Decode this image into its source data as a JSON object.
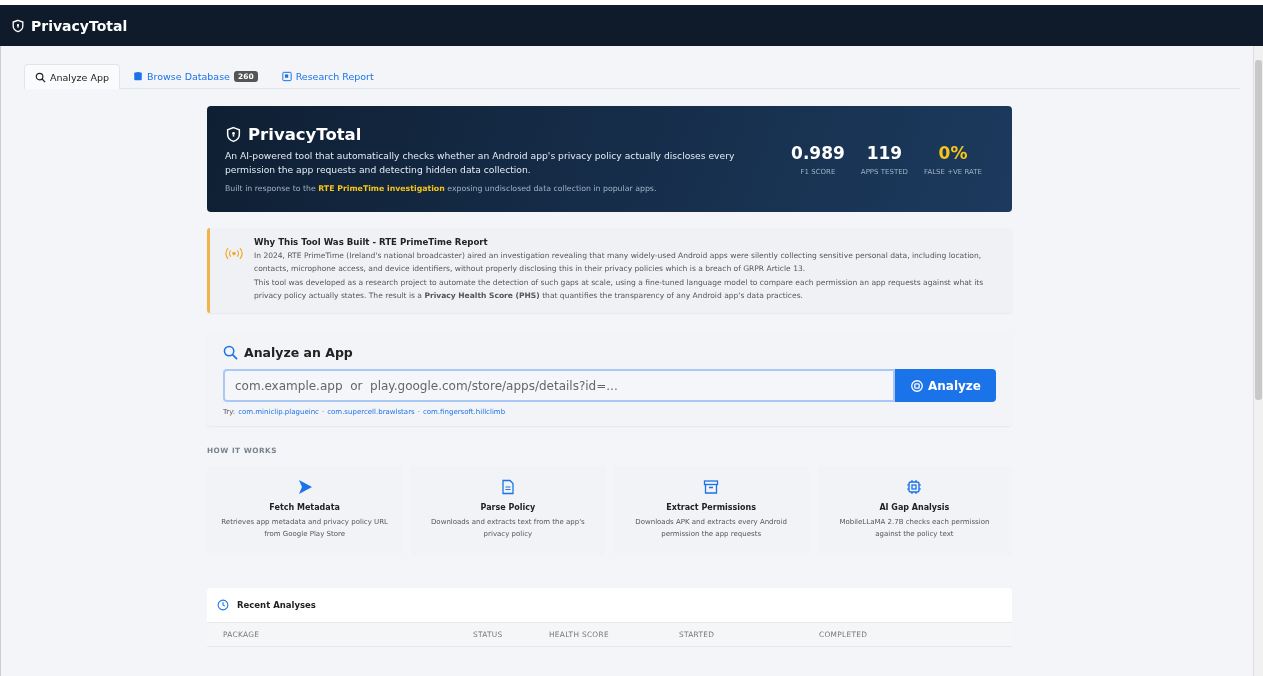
{
  "app_bar": {
    "title": "PrivacyTotal"
  },
  "tabs": [
    {
      "label": "Analyze App",
      "kind": "search",
      "selected": true
    },
    {
      "label": "Browse Database",
      "kind": "database",
      "badge": "260",
      "selected": false
    },
    {
      "label": "Research Report",
      "kind": "report",
      "selected": false
    }
  ],
  "hero": {
    "title": "PrivacyTotal",
    "description": "An AI-powered tool that automatically checks whether an Android app's privacy policy actually discloses every permission the app requests and detecting hidden data collection.",
    "note_before": "Built in response to the",
    "note_link": "RTE PrimeTime investigation",
    "note_after": "exposing undisclosed data collection in popular apps.",
    "stats": [
      {
        "value": "0.989",
        "label": "F1 SCORE",
        "color": "#ffffff"
      },
      {
        "value": "119",
        "label": "APPS TESTED",
        "color": "#ffffff"
      },
      {
        "value": "0%",
        "label": "FALSE +VE RATE",
        "color": "#f5c518"
      }
    ]
  },
  "notice": {
    "title": "Why This Tool Was Built - RTE PrimeTime Report",
    "paragraphs": [
      "In 2024, RTE PrimeTime (Ireland's national broadcaster) aired an investigation revealing that many widely-used Android apps were silently collecting sensitive personal data, including location, contacts, microphone access, and device identifiers, without properly disclosing this in their privacy policies which is a breach of GRPR Article 13.",
      "This tool was developed as a research project to automate the detection of such gaps at scale, using a fine-tuned language model to compare each permission an app requests against what its privacy policy actually states. The result is a **Privacy Health Score (PHS)** that quantifies the transparency of any Android app's data practices."
    ]
  },
  "analyze": {
    "title": "Analyze an App",
    "placeholder": "com.example.app  or  play.google.com/store/apps/details?id=...",
    "button": "Analyze",
    "try_label": "Try:",
    "separator": "·",
    "try_links": [
      "com.miniclip.plagueinc",
      "com.supercell.brawlstars",
      "com.fingersoft.hillclimb"
    ]
  },
  "how_it_works": {
    "heading": "HOW IT WORKS",
    "steps": [
      {
        "kind": "play",
        "title": "Fetch Metadata",
        "description": "Retrieves app metadata and privacy policy URL from Google Play Store"
      },
      {
        "kind": "document",
        "title": "Parse Policy",
        "description": "Downloads and extracts text from the app's privacy policy"
      },
      {
        "kind": "archive",
        "title": "Extract Permissions",
        "description": "Downloads APK and extracts every Android permission the app requests"
      },
      {
        "kind": "chip",
        "title": "AI Gap Analysis",
        "description": "MobileLLaMA 2.7B checks each permission against the policy text"
      }
    ]
  },
  "recent": {
    "title": "Recent Analyses",
    "columns": [
      "PACKAGE",
      "STATUS",
      "HEALTH SCORE",
      "STARTED",
      "COMPLETED"
    ]
  }
}
